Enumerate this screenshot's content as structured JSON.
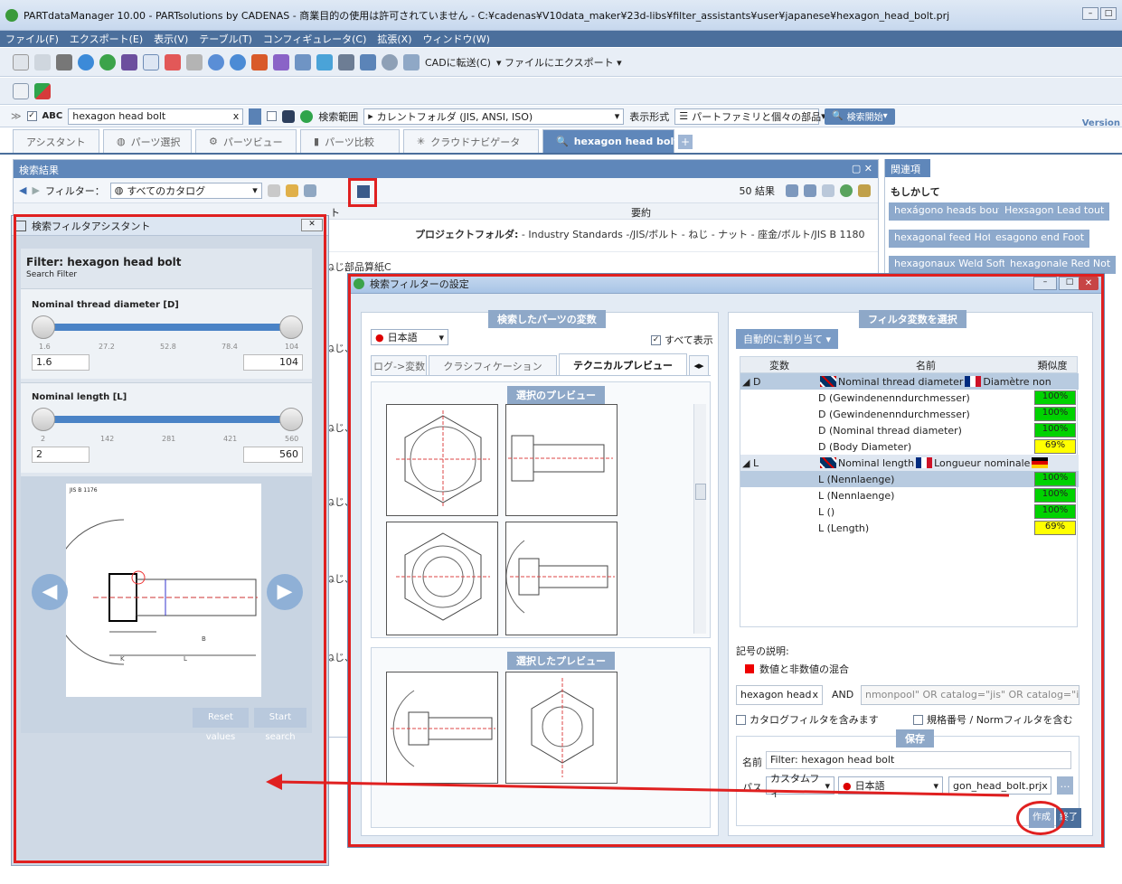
{
  "window": {
    "title": "PARTdataManager 10.00 - PARTsolutions by CADENAS - 商業目的の使用は許可されていません - C:¥cadenas¥V10data_maker¥23d-libs¥filter_assistants¥user¥japanese¥hexagon_head_bolt.prj"
  },
  "menu": [
    "ファイル(F)",
    "エクスポート(E)",
    "表示(V)",
    "テーブル(T)",
    "コンフィギュレータ(C)",
    "拡張(X)",
    "ウィンドウ(W)"
  ],
  "toolbar": {
    "cad_transfer": "CADに転送(C)",
    "file_export": "ファイルにエクスポート"
  },
  "search": {
    "abc_label": "ABC",
    "query": "hexagon head bolt",
    "clear": "x",
    "scope_label": "検索範囲",
    "scope_value": "カレントフォルダ (JIS, ANSI, ISO)",
    "display_label": "表示形式",
    "display_value": "パートファミリと個々の部品",
    "start_button": "検索開始",
    "version_label": "Version"
  },
  "tabs": [
    {
      "label": "アシスタント"
    },
    {
      "label": "パーツ選択"
    },
    {
      "label": "パーツビュー"
    },
    {
      "label": "パーツ比較"
    },
    {
      "label": "クラウドナビゲータ"
    },
    {
      "label": "hexagon head bolt"
    }
  ],
  "results": {
    "header": "検索結果",
    "filter_label": "フィルター：",
    "filter_value": "すべてのカタログ",
    "count": "50 結果",
    "col_summary": "要約",
    "col_part_fragment": "ト",
    "project_folder_label": "プロジェクトフォルダ:",
    "project_folder_value": "- Industry Standards -/JIS/ボルト - ねじ - ナット - 座金/ボルト/JIS B 1180",
    "row_fragment": "ねじ、",
    "row_fragment_2": "部品算紙C"
  },
  "related": {
    "header": "関連項目",
    "maybe_label": "もしかして",
    "tags": [
      "hexágono heads bout",
      "Hexsagon Lead tout",
      "hexagonal feed Hot",
      "esagono end Foot",
      "hexagonaux Weld Soft",
      "hexagonale Red Not"
    ]
  },
  "assistant": {
    "title": "検索フィルタアシスタント",
    "filter_name": "Filter: hexagon head bolt",
    "subtitle": "Search Filter",
    "d_label": "Nominal thread diameter [D]",
    "d_ticks": [
      "1.6",
      "27.2",
      "52.8",
      "78.4",
      "104"
    ],
    "d_min": "1.6",
    "d_max": "104",
    "l_label": "Nominal length [L]",
    "l_ticks": [
      "2",
      "142",
      "281",
      "421",
      "560"
    ],
    "l_min": "2",
    "l_max": "560",
    "drawing_label": "JIS B 1176",
    "reset_button": "Reset values",
    "start_button": "Start search"
  },
  "dialog": {
    "title": "検索フィルターの設定",
    "left_header": "検索したパーツの変数",
    "language": "日本語",
    "show_all": "すべて表示",
    "subtabs": [
      "ログ->変数",
      "クラシフィケーション",
      "テクニカルプレビュー"
    ],
    "preview_header": "選択のプレビュー",
    "selected_preview_header": "選択したプレビュー",
    "right_header": "フィルタ変数を選択",
    "auto_assign": "自動的に割り当て",
    "col_var": "変数",
    "col_name": "名前",
    "col_sim": "類似度",
    "groups": [
      {
        "var": "D",
        "name_en": "Nominal thread diameter",
        "name_fr": "Diamètre non",
        "rows": [
          {
            "name": "D (Gewindenenndurchmesser)",
            "sim": "100%",
            "level": "g"
          },
          {
            "name": "D (Gewindenenndurchmesser)",
            "sim": "100%",
            "level": "g"
          },
          {
            "name": "D (Nominal thread diameter)",
            "sim": "100%",
            "level": "g"
          },
          {
            "name": "D (Body Diameter)",
            "sim": "69%",
            "level": "y"
          }
        ]
      },
      {
        "var": "L",
        "name_en": "Nominal length",
        "name_fr": "Longueur nominale",
        "rows": [
          {
            "name": "L (Nennlaenge)",
            "sim": "100%",
            "level": "g"
          },
          {
            "name": "L (Nennlaenge)",
            "sim": "100%",
            "level": "g"
          },
          {
            "name": "L ()",
            "sim": "100%",
            "level": "g"
          },
          {
            "name": "L (Length)",
            "sim": "69%",
            "level": "y"
          }
        ]
      }
    ],
    "legend_title": "記号の説明:",
    "legend_item": "数値と非数値の混合",
    "query_left": "hexagon head",
    "query_and": "AND",
    "query_right": "nmonpool\" OR catalog=\"jis\" OR catalog=\"iso\")))",
    "include_catalog": "カタログフィルタを含みます",
    "include_norm": "規格番号 / Normフィルタを含む",
    "save_header": "保存",
    "name_label": "名前",
    "name_value": "Filter: hexagon head bolt",
    "path_label": "パス",
    "path_value": "カスタムフィ",
    "path_lang": "日本語",
    "file_value": "gon_head_bolt.prj",
    "create_button": "作成",
    "close_button": "終了"
  }
}
